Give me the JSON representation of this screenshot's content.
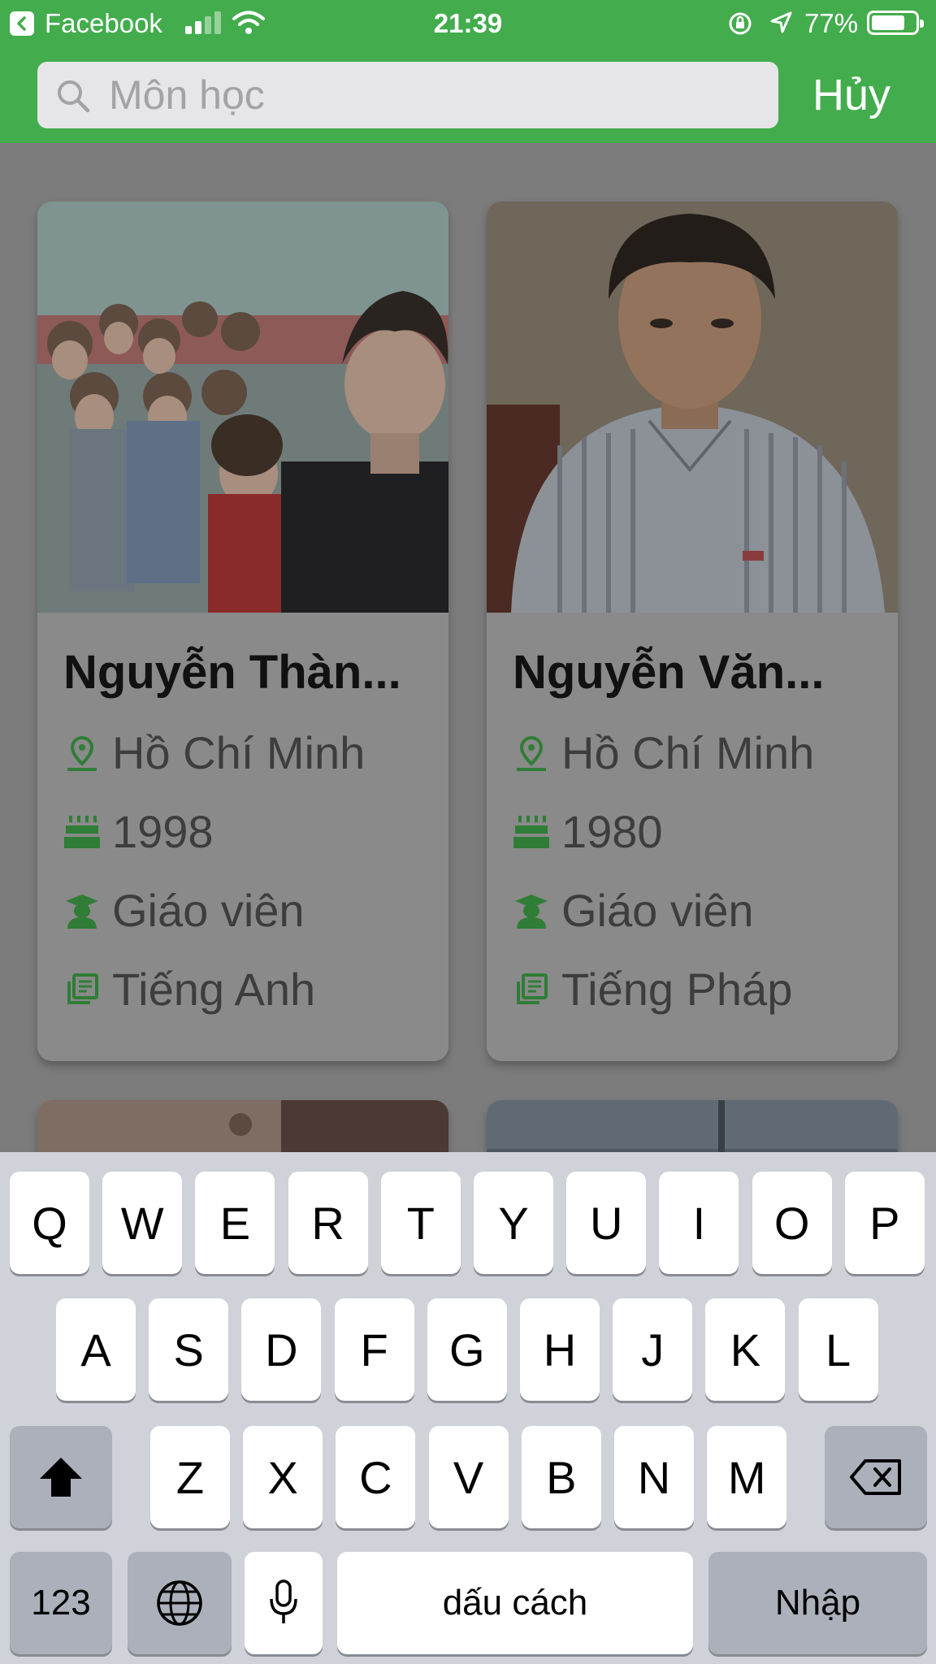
{
  "status_bar": {
    "back_app": "Facebook",
    "time": "21:39",
    "battery_percent": "77%",
    "battery_level": 0.77
  },
  "search": {
    "placeholder": "Môn học",
    "value": "",
    "cancel_label": "Hủy"
  },
  "teachers": [
    {
      "name": "Nguyễn Thàn...",
      "location": "Hồ Chí Minh",
      "birth_year": "1998",
      "role": "Giáo viên",
      "subject": "Tiếng Anh"
    },
    {
      "name": "Nguyễn Văn...",
      "location": "Hồ Chí Minh",
      "birth_year": "1980",
      "role": "Giáo viên",
      "subject": "Tiếng Pháp"
    }
  ],
  "keyboard": {
    "row1": [
      "Q",
      "W",
      "E",
      "R",
      "T",
      "Y",
      "U",
      "I",
      "O",
      "P"
    ],
    "row2": [
      "A",
      "S",
      "D",
      "F",
      "G",
      "H",
      "J",
      "K",
      "L"
    ],
    "row3": [
      "Z",
      "X",
      "C",
      "V",
      "B",
      "N",
      "M"
    ],
    "numbers_label": "123",
    "space_label": "dấu cách",
    "return_label": "Nhập"
  },
  "colors": {
    "header_green": "#43ac4d",
    "icon_green": "#2f7d36",
    "overlay_gray": "#7c7c7c"
  }
}
